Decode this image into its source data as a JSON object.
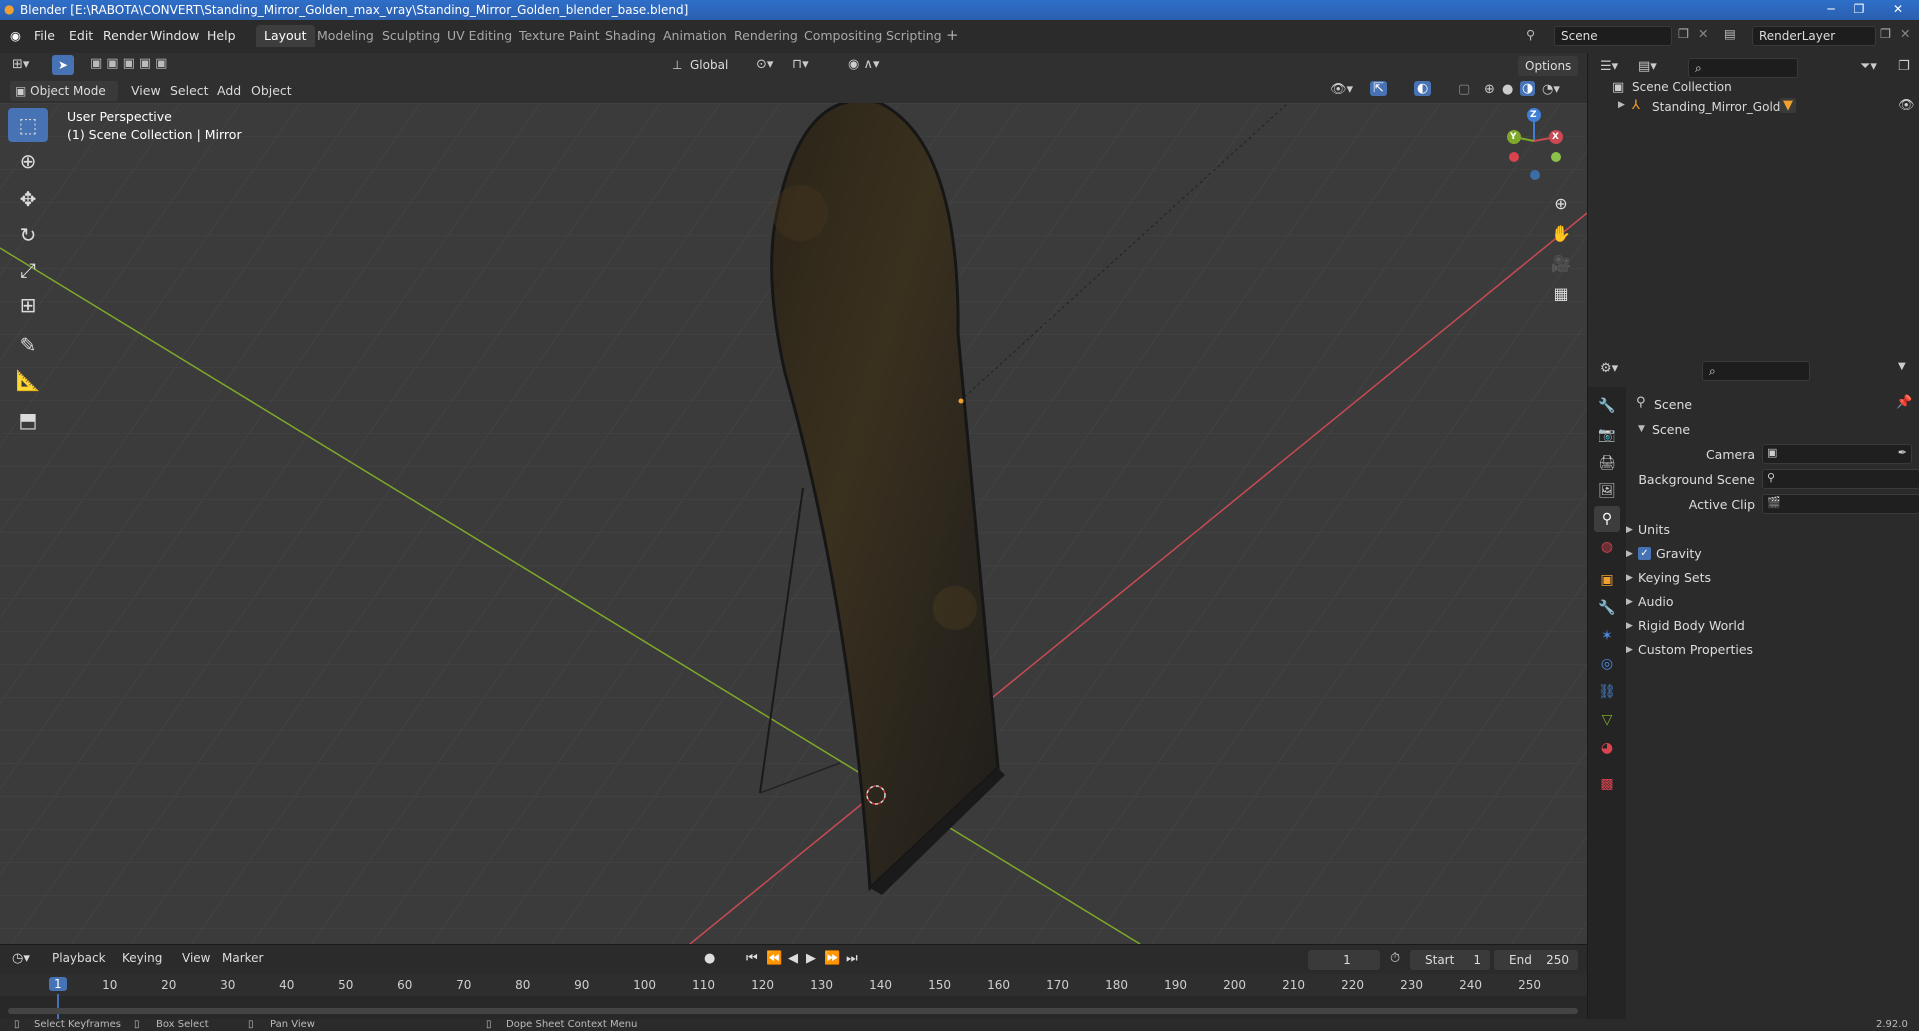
{
  "window": {
    "title": "Blender [E:\\RABOTA\\CONVERT\\Standing_Mirror_Golden_max_vray\\Standing_Mirror_Golden_blender_base.blend]"
  },
  "menu": [
    "File",
    "Edit",
    "Render",
    "Window",
    "Help"
  ],
  "workspaces": [
    "Layout",
    "Modeling",
    "Sculpting",
    "UV Editing",
    "Texture Paint",
    "Shading",
    "Animation",
    "Rendering",
    "Compositing",
    "Scripting"
  ],
  "active_workspace": "Layout",
  "scene_field": "Scene",
  "render_layer_field": "RenderLayer",
  "toolrow": {
    "orientation": "Global",
    "options": "Options"
  },
  "viewport_header": {
    "mode": "Object Mode",
    "menus": [
      "View",
      "Select",
      "Add",
      "Object"
    ]
  },
  "viewport": {
    "perspective": "User Perspective",
    "collection": "(1) Scene Collection | Mirror",
    "gizmo_axes": [
      "Z",
      "Y",
      "X"
    ]
  },
  "outliner": {
    "root": "Scene Collection",
    "items": [
      "Standing_Mirror_Golden"
    ]
  },
  "properties": {
    "context": "Scene",
    "panel": "Scene",
    "fields": [
      {
        "label": "Camera"
      },
      {
        "label": "Background Scene"
      },
      {
        "label": "Active Clip"
      }
    ],
    "subpanels": [
      "Units",
      "Gravity",
      "Keying Sets",
      "Audio",
      "Rigid Body World",
      "Custom Properties"
    ],
    "gravity_checked": true
  },
  "timeline": {
    "menus": [
      "Playback",
      "Keying",
      "View",
      "Marker"
    ],
    "current_frame": "1",
    "start_label": "Start",
    "start": "1",
    "end_label": "End",
    "end": "250",
    "ruler": [
      "1",
      "10",
      "20",
      "30",
      "40",
      "50",
      "60",
      "70",
      "80",
      "90",
      "100",
      "110",
      "120",
      "130",
      "140",
      "150",
      "160",
      "170",
      "180",
      "190",
      "200",
      "210",
      "220",
      "230",
      "240",
      "250"
    ]
  },
  "statusbar": {
    "items": [
      "Select Keyframes",
      "Box Select",
      "Pan View",
      "Dope Sheet Context Menu"
    ],
    "version": "2.92.0"
  },
  "colors": {
    "accent": "#4772b3",
    "x_axis": "#c94a52",
    "y_axis": "#7fa82a",
    "z_axis": "#3f80d6"
  }
}
